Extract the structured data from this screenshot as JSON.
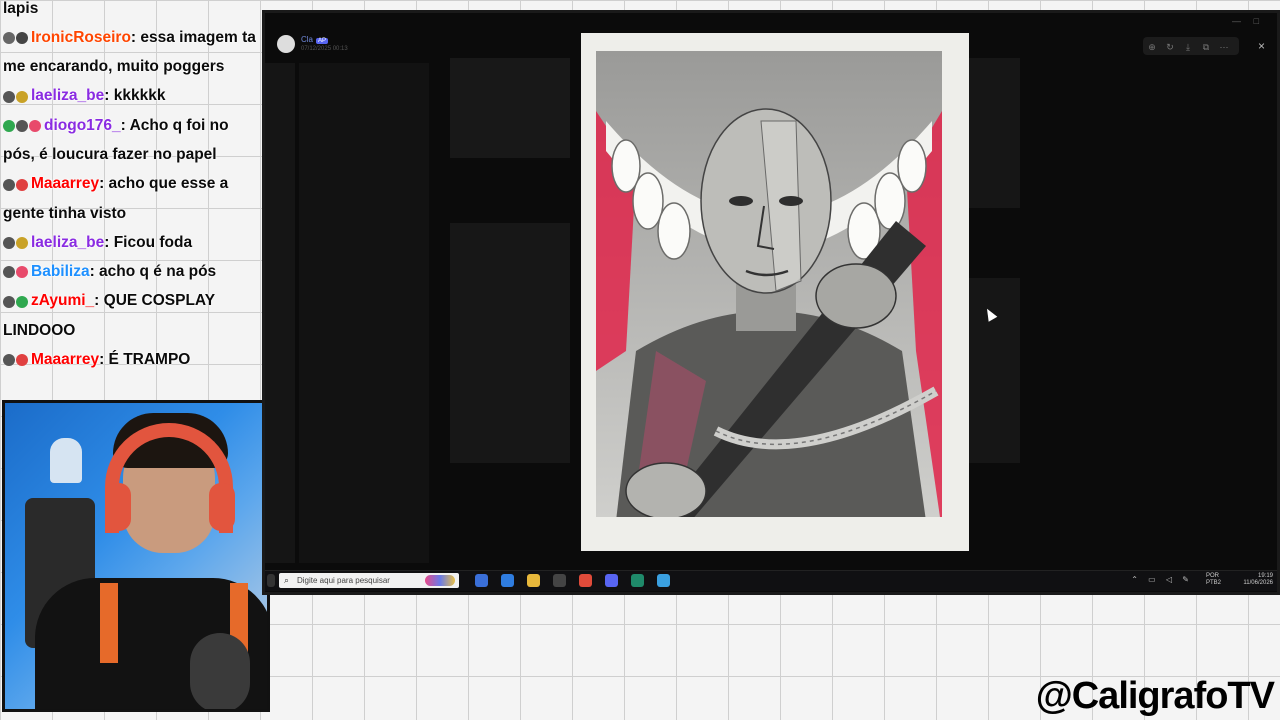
{
  "chat": {
    "messages": [
      {
        "user": "",
        "text": "lapis",
        "color": "#000000"
      },
      {
        "user": "IronicRoseiro",
        "text": "essa imagem ta me encarando, muito poggers",
        "color": "#ff4500",
        "badges": [
          "#666666",
          "#444444"
        ]
      },
      {
        "user": "laeliza_be",
        "text": "kkkkkk",
        "color": "#8a2be2",
        "badges": [
          "#555555",
          "#c9a227"
        ]
      },
      {
        "user": "diogo176_",
        "text": "Acho q foi no pós, é loucura fazer no papel",
        "color": "#8a2be2",
        "badges": [
          "#2fa84f",
          "#555555",
          "#e84a6b"
        ]
      },
      {
        "user": "Maaarrey",
        "text": "acho que esse a gente tinha visto",
        "color": "#ff0000",
        "badges": [
          "#555555",
          "#e04040"
        ]
      },
      {
        "user": "laeliza_be",
        "text": "Ficou foda",
        "color": "#8a2be2",
        "badges": [
          "#555555",
          "#c9a227"
        ]
      },
      {
        "user": "Babiliza",
        "text": "acho q é na pós",
        "color": "#1e90ff",
        "badges": [
          "#555555",
          "#e84a6b"
        ]
      },
      {
        "user": "zAyumi_",
        "text": "QUE COSPLAY LINDOOO",
        "color": "#ff0000",
        "badges": [
          "#555555",
          "#2fa84f"
        ]
      },
      {
        "user": "Maaarrey",
        "text": "É TRAMPO",
        "color": "#ff0000",
        "badges": [
          "#555555",
          "#e04040"
        ]
      }
    ]
  },
  "viewer": {
    "user": "Cla",
    "tag": "AP",
    "date": "07/12/2025 00:13",
    "tools": [
      "⊕",
      "↻",
      "⤓",
      "⧉",
      "⋯"
    ],
    "close_icon": "×"
  },
  "taskbar": {
    "search_placeholder": "Digite aqui para pesquisar",
    "lang": "POR",
    "lang2": "PTB2",
    "time": "19:19",
    "date": "11/06/2026",
    "icons": [
      {
        "name": "file-explorer-icon",
        "color": "#3a6fd8"
      },
      {
        "name": "store-icon",
        "color": "#2f7de0"
      },
      {
        "name": "folder-icon",
        "color": "#e8b83b"
      },
      {
        "name": "obs-icon",
        "color": "#444444"
      },
      {
        "name": "chrome-icon",
        "color": "#e04b3a"
      },
      {
        "name": "discord-icon",
        "color": "#5865f2"
      },
      {
        "name": "terminal-icon",
        "color": "#1f8a6a"
      },
      {
        "name": "refresh-icon",
        "color": "#3aa0e0"
      }
    ]
  },
  "watermark": "@CaligrafoTV",
  "colors": {
    "accent_red": "#e0244a",
    "screen_bg": "#0b0b0b"
  }
}
